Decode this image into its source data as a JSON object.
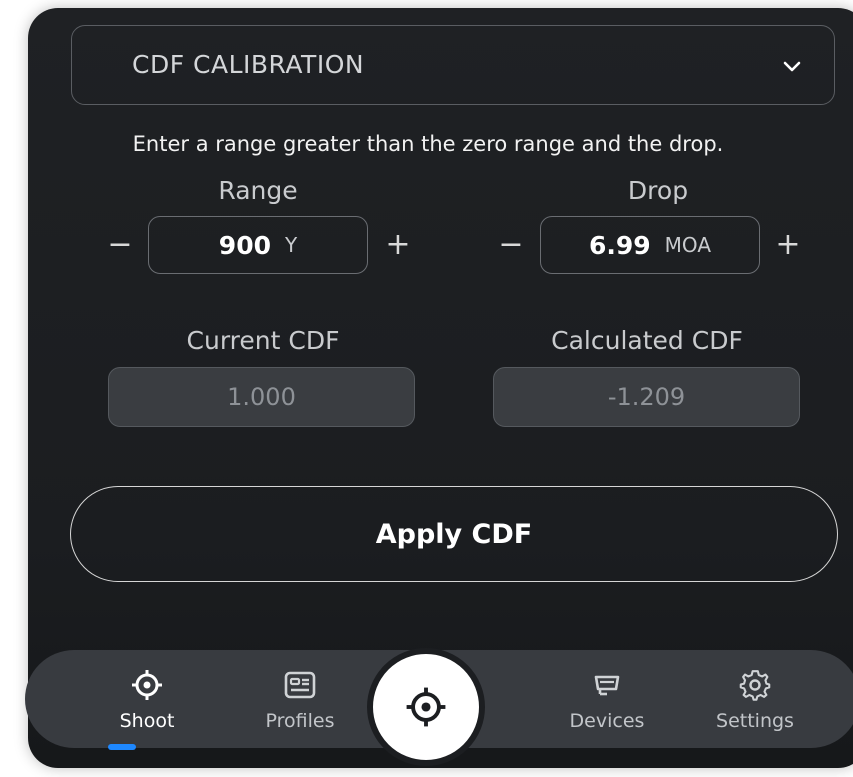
{
  "dropdown": {
    "label": "CDF CALIBRATION",
    "icon": "chevron-down-icon"
  },
  "hint": "Enter a range greater than the zero range and the drop.",
  "range": {
    "title": "Range",
    "value": "900",
    "unit": "Y",
    "minus": "−",
    "plus": "+"
  },
  "drop": {
    "title": "Drop",
    "value": "6.99",
    "unit": "MOA",
    "minus": "−",
    "plus": "+"
  },
  "current_cdf": {
    "title": "Current CDF",
    "value": "1.000"
  },
  "calculated_cdf": {
    "title": "Calculated CDF",
    "value": "-1.209"
  },
  "apply_button": "Apply CDF",
  "nav": {
    "items": [
      {
        "label": "Shoot",
        "icon": "crosshair-icon"
      },
      {
        "label": "Profiles",
        "icon": "profile-card-icon"
      },
      {
        "label": "Devices",
        "icon": "device-icon"
      },
      {
        "label": "Settings",
        "icon": "gear-icon"
      }
    ],
    "center_icon": "crosshair-icon",
    "accent": "#1e88ff"
  }
}
